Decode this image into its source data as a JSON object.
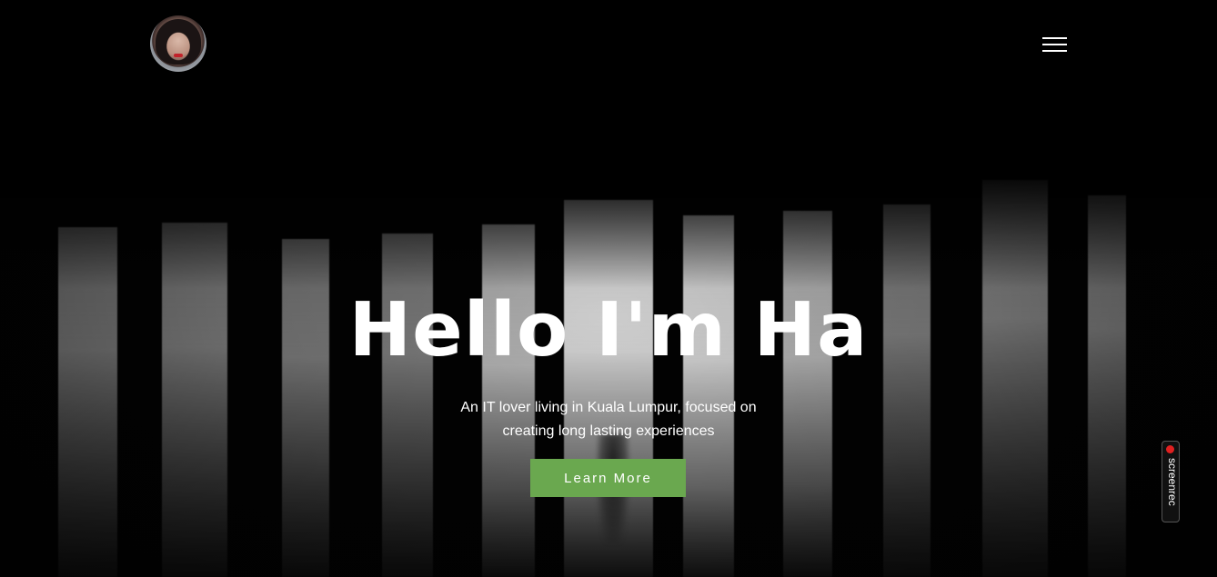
{
  "header": {
    "avatar_alt": "profile photo",
    "menu_icon": "hamburger-menu-icon"
  },
  "hero": {
    "title": "Hello I'm Ha",
    "subtitle_line1": "An IT lover living in Kuala Lumpur, focused on",
    "subtitle_line2": "creating long lasting experiences",
    "cta_label": "Learn More"
  },
  "overlay": {
    "recorder_label": "screenrec"
  },
  "colors": {
    "background": "#000000",
    "text": "#ffffff",
    "accent": "#6aa84f"
  }
}
